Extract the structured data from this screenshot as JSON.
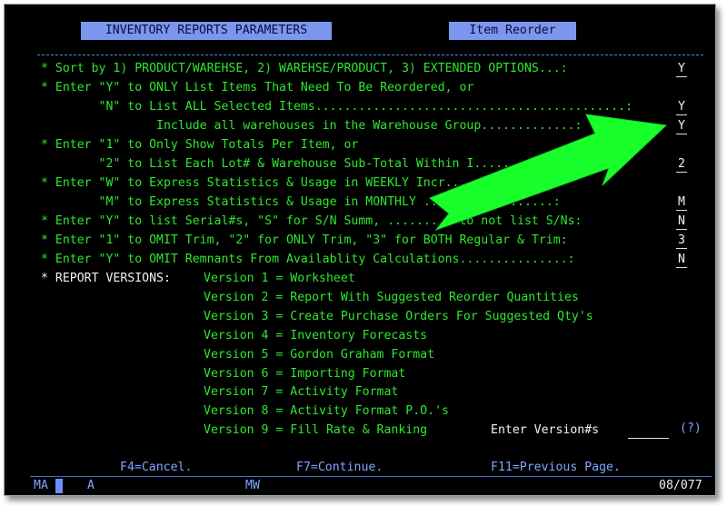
{
  "header": {
    "title": "INVENTORY REPORTS PARAMETERS",
    "subtitle": "Item Reorder"
  },
  "options": [
    {
      "text": "* Sort by 1) PRODUCT/WAREHSE, 2) WAREHSE/PRODUCT, 3) EXTENDED OPTIONS...:",
      "value": "Y"
    },
    {
      "text": "* Enter \"Y\" to ONLY List Items That Need To Be Reordered, or",
      "value": ""
    },
    {
      "text": "        \"N\" to List ALL Selected Items...........................................:",
      "value": "Y"
    },
    {
      "text": "                Include all warehouses in the Warehouse Group.............:",
      "value": "Y"
    },
    {
      "text": "* Enter \"1\" to Only Show Totals Per Item, or",
      "value": ""
    },
    {
      "text": "        \"2\" to List Each Lot# & Warehouse Sub-Total Within I........:",
      "value": "2"
    },
    {
      "text": "* Enter \"W\" to Express Statistics & Usage in WEEKLY Incr...  or",
      "value": ""
    },
    {
      "text": "        \"M\" to Express Statistics & Usage in MONTHLY ...ements.........:",
      "value": "M"
    },
    {
      "text": "* Enter \"Y\" to list Serial#s, \"S\" for S/N Summ, ......... to not list S/Ns:",
      "value": "N"
    },
    {
      "text": "* Enter \"1\" to OMIT Trim, \"2\" for ONLY Trim, \"3\" for BOTH Regular & Trim:",
      "value": "3"
    },
    {
      "text": "* Enter \"Y\" to OMIT Remnants From Availablity Calculations...............:",
      "value": "N"
    }
  ],
  "versions": {
    "label": "* REPORT VERSIONS:",
    "items": [
      "Version 1 = Worksheet",
      "Version 2 = Report With Suggested Reorder Quantities",
      "Version 3 = Create Purchase Orders For Suggested Qty's",
      "Version 4 = Inventory Forecasts",
      "Version 5 = Gordon Graham Format",
      "Version 6 = Importing Format",
      "Version 7 = Activity Format",
      "Version 8 = Activity Format P.O.'s",
      "Version 9 = Fill Rate & Ranking"
    ],
    "input_label": "Enter Version#s",
    "input_value": "",
    "help": "(?)"
  },
  "function_keys": {
    "f4": "F4=Cancel.",
    "f7": "F7=Continue.",
    "f11": "F11=Previous Page."
  },
  "status_bar": {
    "left": "MA",
    "a": "A",
    "mw": "MW",
    "position": "08/077"
  },
  "colors": {
    "background": "#000000",
    "text_green": "#2ee82e",
    "highlight_blue": "#7b96ec",
    "arrow_green": "#19ff2c"
  }
}
